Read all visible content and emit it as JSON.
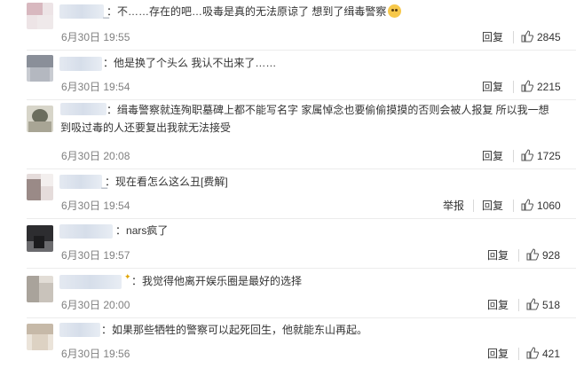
{
  "comments": [
    {
      "text": "不……存在的吧…吸毒是真的无法原谅了 想到了缉毒警察",
      "time": "6月30日 19:55",
      "reply": "回复",
      "likes": "2845",
      "avatar_colors": [
        "#d8b8bf",
        "#ede4e6"
      ]
    },
    {
      "text": "他是换了个头么 我认不出来了……",
      "time": "6月30日 19:54",
      "reply": "回复",
      "likes": "2215",
      "avatar_colors": [
        "#8a8f99",
        "#c9ccd2"
      ]
    },
    {
      "text": "缉毒警察就连殉职墓碑上都不能写名字 家属悼念也要偷偷摸摸的否则会被人报复 所以我一想到吸过毒的人还要复出我就无法接受",
      "time": "6月30日 20:08",
      "reply": "回复",
      "likes": "1725",
      "avatar_colors": [
        "#6b6d5e",
        "#d7d5c9"
      ]
    },
    {
      "text": "现在看怎么这么丑[费解]",
      "time": "6月30日 19:54",
      "report": "举报",
      "reply": "回复",
      "likes": "1060",
      "avatar_colors": [
        "#9a8a87",
        "#e5dcdb"
      ]
    },
    {
      "text": "nars疯了",
      "time": "6月30日 19:57",
      "reply": "回复",
      "likes": "928",
      "avatar_colors": [
        "#2d2d30",
        "#6b6b6e"
      ]
    },
    {
      "text": "我觉得他离开娱乐圈是最好的选择",
      "time": "6月30日 20:00",
      "reply": "回复",
      "likes": "518",
      "avatar_colors": [
        "#a9a39b",
        "#e2ddd6"
      ]
    },
    {
      "text": "如果那些牺牲的警察可以起死回生，他就能东山再起。",
      "time": "6月30日 19:56",
      "reply": "回复",
      "likes": "421",
      "avatar_colors": [
        "#c6b9a8",
        "#ebe4da"
      ]
    }
  ],
  "icons": {
    "like": "thumbs-up-icon",
    "emoji": "smile-emoji-icon"
  },
  "colors": {
    "time": "#808080",
    "divider": "#ececec",
    "text": "#333333"
  }
}
